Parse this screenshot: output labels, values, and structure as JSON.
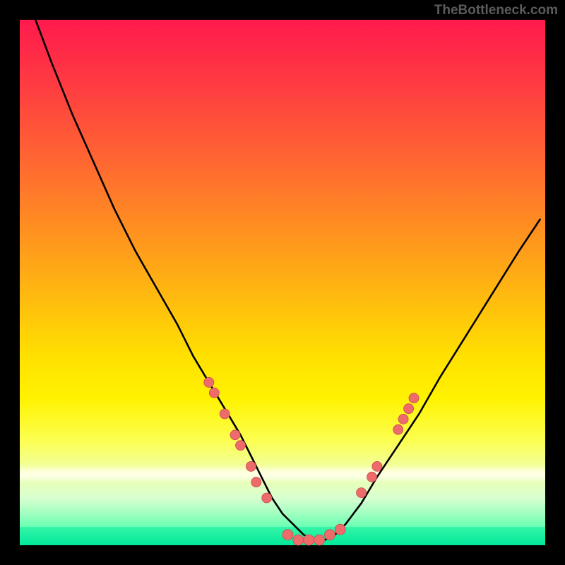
{
  "attribution": "TheBottleneck.com",
  "colors": {
    "curve": "#000000",
    "marker_fill": "#ed6b6b",
    "marker_stroke": "#c94d4d",
    "frame": "#000000"
  },
  "chart_data": {
    "type": "line",
    "title": "",
    "xlabel": "",
    "ylabel": "",
    "xlim": [
      0,
      100
    ],
    "ylim": [
      0,
      100
    ],
    "grid": false,
    "legend": false,
    "series": [
      {
        "name": "bottleneck-curve",
        "x": [
          3,
          6,
          10,
          14,
          18,
          22,
          26,
          30,
          33,
          36,
          39,
          42,
          44,
          46,
          48,
          50,
          52,
          54,
          56,
          58,
          60,
          62,
          65,
          68,
          72,
          76,
          80,
          85,
          90,
          95,
          99
        ],
        "y": [
          100,
          92,
          82,
          73,
          64,
          56,
          49,
          42,
          36,
          31,
          26,
          21,
          17,
          13,
          9,
          6,
          4,
          2,
          1,
          1,
          2,
          4,
          8,
          13,
          19,
          25,
          32,
          40,
          48,
          56,
          62
        ]
      }
    ],
    "markers_left": [
      {
        "x": 36,
        "y": 31
      },
      {
        "x": 37,
        "y": 29
      },
      {
        "x": 39,
        "y": 25
      },
      {
        "x": 41,
        "y": 21
      },
      {
        "x": 42,
        "y": 19
      },
      {
        "x": 44,
        "y": 15
      },
      {
        "x": 45,
        "y": 12
      },
      {
        "x": 47,
        "y": 9
      }
    ],
    "markers_bottom": [
      {
        "x": 51,
        "y": 2
      },
      {
        "x": 53,
        "y": 1
      },
      {
        "x": 55,
        "y": 1
      },
      {
        "x": 57,
        "y": 1
      },
      {
        "x": 59,
        "y": 2
      },
      {
        "x": 61,
        "y": 3
      }
    ],
    "markers_right": [
      {
        "x": 65,
        "y": 10
      },
      {
        "x": 67,
        "y": 13
      },
      {
        "x": 68,
        "y": 15
      },
      {
        "x": 72,
        "y": 22
      },
      {
        "x": 73,
        "y": 24
      },
      {
        "x": 74,
        "y": 26
      },
      {
        "x": 75,
        "y": 28
      }
    ]
  }
}
